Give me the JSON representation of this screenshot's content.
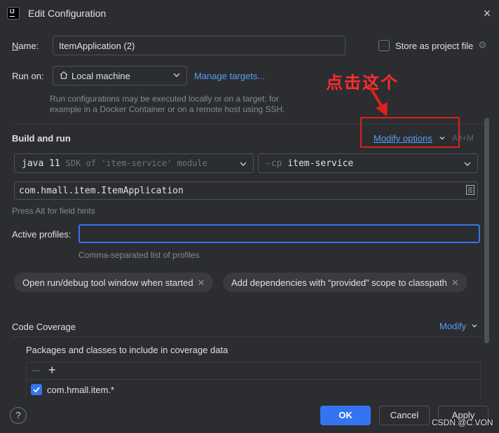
{
  "window": {
    "title": "Edit Configuration",
    "close_label": "×",
    "app_icon_text": "IJ"
  },
  "name": {
    "label_u": "N",
    "label_rest": "ame:",
    "value": "ItemApplication (2)"
  },
  "store": {
    "label": "Store as project file"
  },
  "run_on": {
    "label": "Run on:",
    "selected": "Local machine",
    "manage_link": "Manage targets...",
    "help": "Run configurations may be executed locally or on a target: for example in a Docker Container or on a remote host using SSH."
  },
  "annotation": {
    "text": "点击这个",
    "color": "#ff2d2d"
  },
  "build_run": {
    "title": "Build and run",
    "modify_options": "Modify options",
    "shortcut": "Alt+M",
    "jdk_main": "java 11",
    "jdk_dim": "SDK of 'item-service' module",
    "cp_dim": "-cp",
    "cp_main": "item-service",
    "main_class": "com.hmall.item.ItemApplication",
    "field_hint": "Press Alt for field hints"
  },
  "profiles": {
    "label": "Active profiles:",
    "value": "",
    "hint": "Comma-separated list of profiles"
  },
  "chips": [
    {
      "label": "Open run/debug tool window when started"
    },
    {
      "label": "Add dependencies with “provided” scope to classpath"
    }
  ],
  "coverage": {
    "label": "Code Coverage",
    "modify": "Modify",
    "packages_label": "Packages and classes to include in coverage data",
    "items": [
      {
        "label": "com.hmall.item.*",
        "checked": true
      }
    ]
  },
  "buttons": {
    "help": "?",
    "ok": "OK",
    "cancel": "Cancel",
    "apply": "Apply"
  },
  "watermark": "CSDN @C VON",
  "colors": {
    "accent": "#3574f0",
    "link": "#589df6",
    "background": "#2b2d30",
    "annotation": "#e0201d"
  }
}
